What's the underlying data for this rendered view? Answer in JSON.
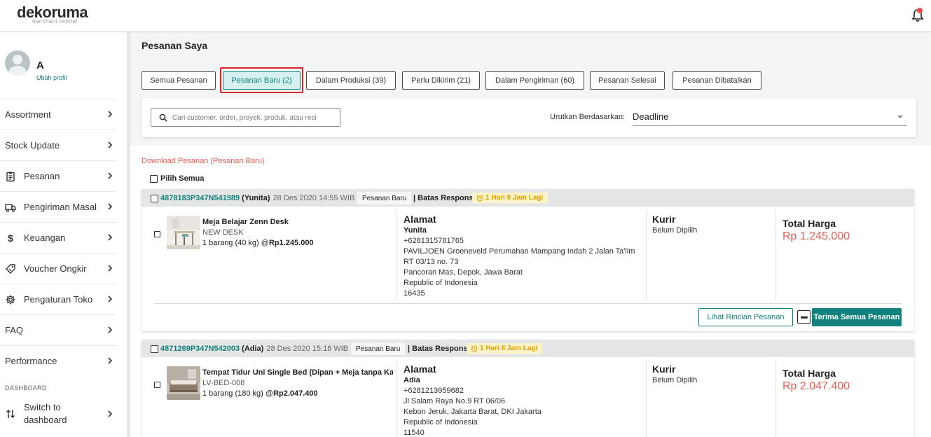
{
  "brand": {
    "name": "dekoruma",
    "sub": "merchant central"
  },
  "profile": {
    "name": "A",
    "edit_label": "Ubah profil"
  },
  "menu": [
    {
      "label": "Assortment",
      "icon": ""
    },
    {
      "label": "Stock Update",
      "icon": ""
    },
    {
      "label": "Pesanan",
      "icon": "clipboard-icon"
    },
    {
      "label": "Pengiriman Masal",
      "icon": "truck-icon"
    },
    {
      "label": "Keuangan",
      "icon": "dollar-icon"
    },
    {
      "label": "Voucher Ongkir",
      "icon": "voucher-icon"
    },
    {
      "label": "Pengaturan Toko",
      "icon": "gear-icon"
    },
    {
      "label": "FAQ",
      "icon": ""
    },
    {
      "label": "Performance",
      "icon": ""
    }
  ],
  "dashboard_section": "DASHBOARD",
  "switch": {
    "line1": "Switch to",
    "line2": "dashboard"
  },
  "page_title": "Pesanan Saya",
  "tabs": [
    {
      "label": "Semua Pesanan",
      "active": false
    },
    {
      "label": "Pesanan Baru (2)",
      "active": true
    },
    {
      "label": "Dalam Produksi (39)",
      "active": false
    },
    {
      "label": "Perlu Dikirim (21)",
      "active": false
    },
    {
      "label": "Dalam Pengiriman (60)",
      "active": false
    },
    {
      "label": "Pesanan Selesai",
      "active": false
    },
    {
      "label": "Pesanan Dibatalkan",
      "active": false
    }
  ],
  "search": {
    "placeholder": "Cari customer, order, proyek, produk, atau resi",
    "value": ""
  },
  "sort": {
    "label": "Urutkan Berdasarkan:",
    "value": "Deadline"
  },
  "download_link": "Download Pesanan (Pesanan Baru)",
  "select_all_label": "Pilih Semua",
  "orders": [
    {
      "id": "4878183P347N541989",
      "customer": "(Yunita)",
      "date": "28 Des 2020 14:55 WIB",
      "status": "Pesanan Baru",
      "batas_label": "| Batas Respons",
      "timer": "1 Hari 8 Jam Lagi",
      "product": {
        "name": "Meja Belajar Zenn Desk",
        "sku": "NEW DESK",
        "qty": "1 barang (40 kg) @",
        "price": "Rp1.245.000"
      },
      "address_title": "Alamat",
      "address": {
        "name": "Yunita",
        "lines": [
          "+6281315781765",
          "PAVILJOEN Groeneveld Perumahan Mampang Indah 2 Jalan Ta'lim",
          "RT 03/13 no. 73",
          "Pancoran Mas, Depok, Jawa Barat",
          "Republic of Indonesia",
          "16435"
        ]
      },
      "kurir_title": "Kurir",
      "kurir": "Belum Dipilih",
      "total_title": "Total Harga",
      "total": "Rp 1.245.000",
      "detail_button": "Lihat Rincian Pesanan",
      "more_button": "•••",
      "accept_button": "Terima Semua Pesanan"
    },
    {
      "id": "4871269P347N542003",
      "customer": "(Adia)",
      "date": "28 Des 2020 15:18 WIB",
      "status": "Pesanan Baru",
      "batas_label": "| Batas Respons",
      "timer": "1 Hari 8 Jam Lagi",
      "product": {
        "name": "Tempat Tidur Uni Single Bed (Dipan + Meja tanpa Ka",
        "sku": "LV-BED-008",
        "qty": "1 barang (180 kg) @",
        "price": "Rp2.047.400"
      },
      "address_title": "Alamat",
      "address": {
        "name": "Adia",
        "lines": [
          "+6281213959682",
          "Jl Salam Raya No.9 RT 06/06",
          "Kebon Jeruk, Jakarta Barat, DKI Jakarta",
          "Republic of Indonesia",
          "11540"
        ]
      },
      "kurir_title": "Kurir",
      "kurir": "Belum Dipilih",
      "total_title": "Total Harga",
      "total": "Rp 2.047.400"
    }
  ],
  "colors": {
    "accent": "#11827e",
    "price": "#e95b52",
    "timer_bg": "#fdf3c8",
    "timer_text": "#e0a100",
    "highlight": "#d9262b"
  }
}
